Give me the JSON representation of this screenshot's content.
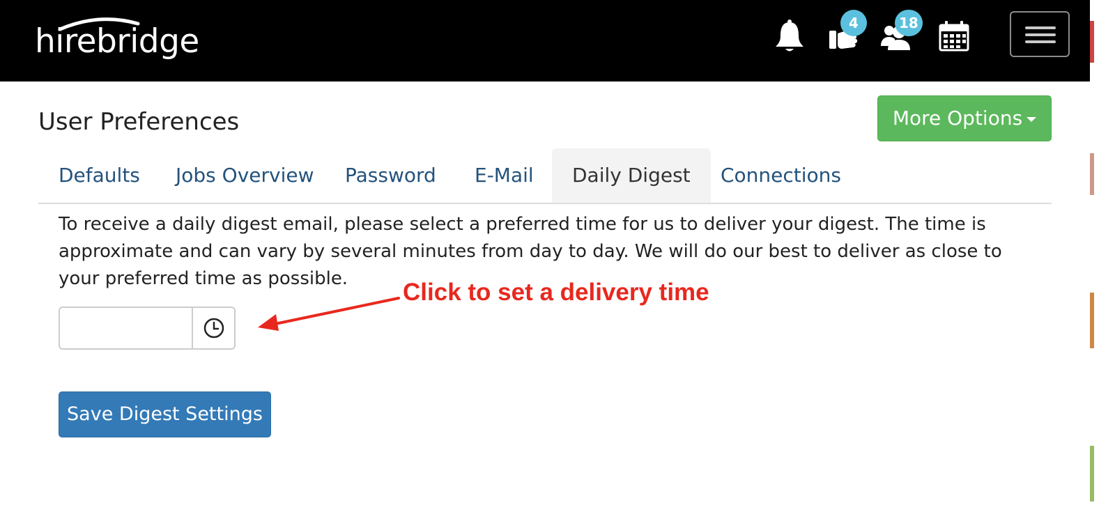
{
  "header": {
    "logo_text": "hirebridge",
    "notifications_icon": "bell-icon",
    "messages_icon": "hand-phone-icon",
    "messages_count": "4",
    "contacts_icon": "users-icon",
    "contacts_count": "18",
    "calendar_icon": "calendar-icon",
    "menu_icon": "hamburger-icon"
  },
  "page": {
    "title": "User Preferences",
    "more_options_label": "More Options"
  },
  "tabs": [
    {
      "label": "Defaults"
    },
    {
      "label": "Jobs Overview"
    },
    {
      "label": "Password"
    },
    {
      "label": "E-Mail"
    },
    {
      "label": "Daily Digest",
      "active": true
    },
    {
      "label": "Connections"
    }
  ],
  "digest": {
    "description": "To receive a daily digest email, please select a preferred time for us to deliver your digest. The time is approximate and can vary by several minutes from day to day. We will do our best to deliver as close to your preferred time as possible.",
    "time_value": "",
    "time_icon": "clock-icon",
    "save_label": "Save Digest Settings"
  },
  "annotation": {
    "text": "Click to set a delivery time",
    "color": "#e8281e"
  },
  "colors": {
    "navbar": "#000000",
    "badge": "#5bc0de",
    "success": "#5cb85c",
    "primary": "#337ab7",
    "tab_link": "#23527c"
  }
}
